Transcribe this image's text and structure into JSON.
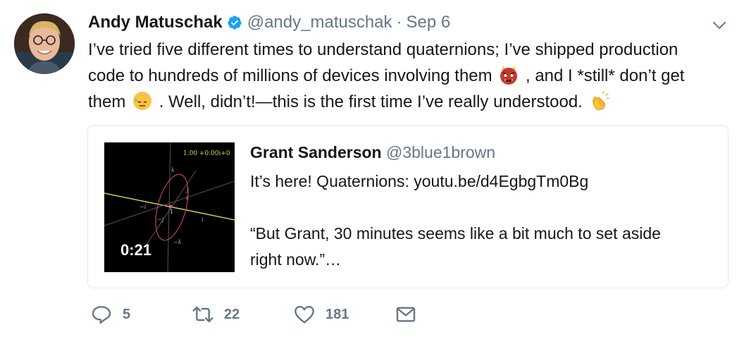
{
  "tweet": {
    "author_name": "Andy Matuschak",
    "author_handle": "@andy_matuschak",
    "separator": "·",
    "date": "Sep 6",
    "text_line1": "I’ve tried five different times to understand quaternions; I’ve shipped production",
    "text_line2a": "code to hundreds of millions of devices involving them",
    "text_line2b": ", and I *still* don’t get",
    "text_line3a": "them",
    "text_line3b": ". Well, didn’t!—this is the first time I’ve really understood.",
    "emojis": [
      "ogre-emoji",
      "sweat-face-emoji",
      "clapping-hands-emoji"
    ]
  },
  "quoted": {
    "author_name": "Grant Sanderson",
    "author_handle": "@3blue1brown",
    "text": "It’s here!  Quaternions: youtu.be/d4EgbgTm0Bg\n\n“But Grant, 30 minutes seems like a bit much to set aside\nright now.”…",
    "video_duration": "0:21",
    "thumb_label": "1.00 +0.00i+0",
    "axis_labels": [
      "k",
      "j",
      "i",
      "1",
      "−i",
      "−j",
      "−k",
      "i"
    ]
  },
  "actions": {
    "replies": "5",
    "retweets": "22",
    "likes": "181"
  },
  "colors": {
    "text": "#14171a",
    "secondary": "#657786",
    "verified": "#1da1f2",
    "border": "#e1e8ed"
  }
}
